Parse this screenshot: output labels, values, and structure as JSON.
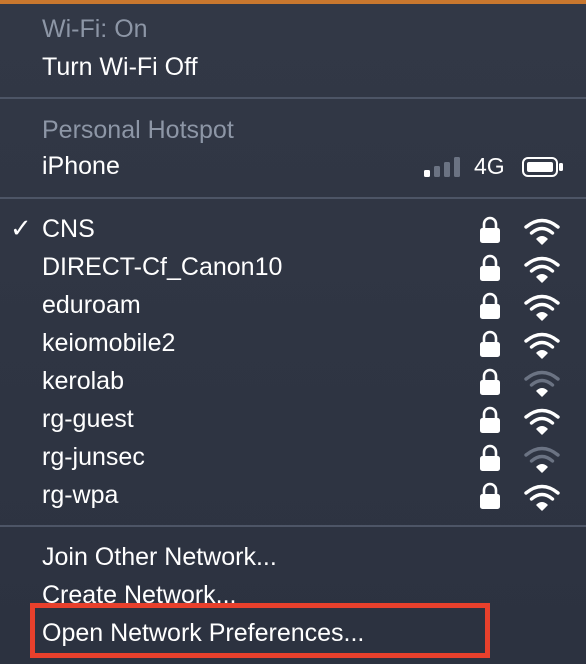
{
  "wifi": {
    "status": "Wi-Fi: On",
    "toggle": "Turn Wi-Fi Off"
  },
  "hotspot": {
    "header": "Personal Hotspot",
    "device": "iPhone",
    "network_type": "4G",
    "signal_bars_active": 1,
    "signal_bars_total": 4
  },
  "networks": [
    {
      "name": "CNS",
      "connected": true,
      "secured": true,
      "signal": "full"
    },
    {
      "name": "DIRECT-Cf_Canon10",
      "connected": false,
      "secured": true,
      "signal": "full"
    },
    {
      "name": "eduroam",
      "connected": false,
      "secured": true,
      "signal": "full"
    },
    {
      "name": "keiomobile2",
      "connected": false,
      "secured": true,
      "signal": "full"
    },
    {
      "name": "kerolab",
      "connected": false,
      "secured": true,
      "signal": "weak"
    },
    {
      "name": "rg-guest",
      "connected": false,
      "secured": true,
      "signal": "full"
    },
    {
      "name": "rg-junsec",
      "connected": false,
      "secured": true,
      "signal": "weak"
    },
    {
      "name": "rg-wpa",
      "connected": false,
      "secured": true,
      "signal": "full"
    }
  ],
  "actions": {
    "join_other": "Join Other Network...",
    "create": "Create Network...",
    "open_prefs": "Open Network Preferences..."
  },
  "checkmark": "✓",
  "colors": {
    "menu_bg": "#2f3543",
    "highlight": "#e8402c",
    "dim_text": "#8d96a6"
  }
}
